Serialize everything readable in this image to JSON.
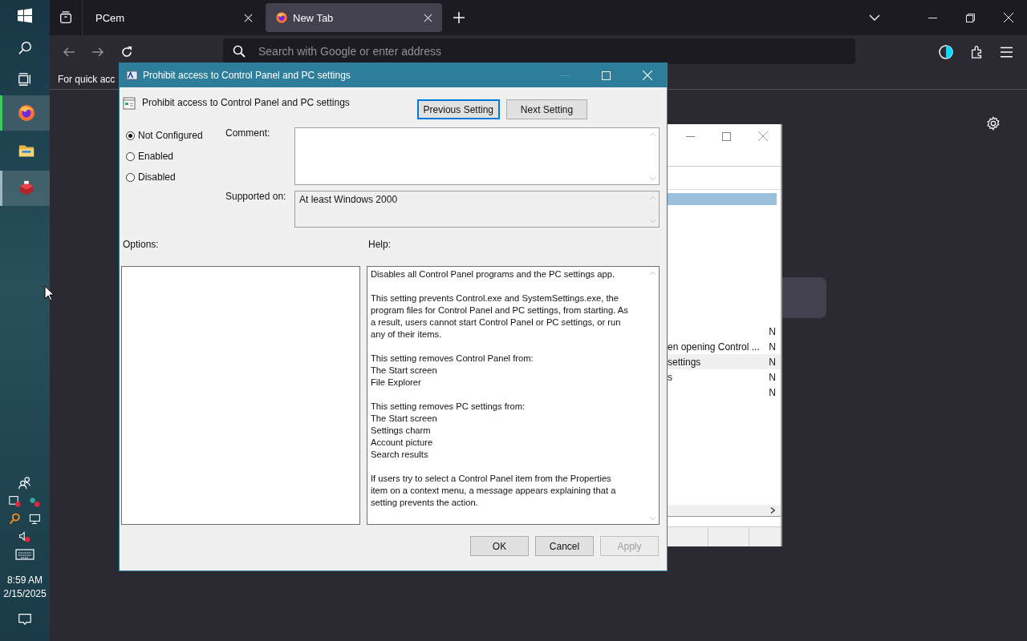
{
  "taskbar": {
    "apps": [
      {
        "kind": "firefox",
        "running": true
      },
      {
        "kind": "folder",
        "running": false
      },
      {
        "kind": "app",
        "running": true
      }
    ],
    "time": "8:59 AM",
    "date": "2/15/2025"
  },
  "browser": {
    "tabs": [
      {
        "label": "PCem",
        "selected": false,
        "kind": "plain"
      },
      {
        "label": "New Tab",
        "selected": true,
        "kind": "firefox"
      }
    ],
    "address": {
      "placeholder": "Search with Google or enter address"
    },
    "notice": "For quick acc"
  },
  "background_window": {
    "rows": [
      {
        "state": "N",
        "selected": false
      },
      {
        "name": "en opening Control ...",
        "state": "N",
        "selected": false
      },
      {
        "name": "settings",
        "state": "N",
        "selected": true
      },
      {
        "name": "s",
        "state": "N",
        "selected": false
      },
      {
        "state": "N",
        "selected": false
      }
    ]
  },
  "dialog": {
    "title": "Prohibit access to Control Panel and PC settings",
    "setting_name": "Prohibit access to Control Panel and PC settings",
    "nav_buttons": [
      {
        "label": "Previous Setting",
        "focused": true
      },
      {
        "label": "Next Setting",
        "focused": false
      }
    ],
    "options": [
      {
        "label": "Not Configured",
        "selected": true
      },
      {
        "label": "Enabled",
        "selected": false
      },
      {
        "label": "Disabled",
        "selected": false
      }
    ],
    "comment_label": "Comment:",
    "supported_label": "Supported on:",
    "supported_value": "At least Windows 2000",
    "options_label": "Options:",
    "help_label": "Help:",
    "help": [
      [
        "Disables all Control Panel programs and the PC settings app."
      ],
      [
        "This setting prevents Control.exe and SystemSettings.exe, the",
        "program files for Control Panel and PC settings, from starting. As",
        "a result, users cannot start Control Panel or PC settings, or run",
        "any of their items."
      ],
      [
        "This setting removes Control Panel from:",
        "The Start screen",
        "File Explorer"
      ],
      [
        "This setting removes PC settings from:",
        "The Start screen",
        "Settings charm",
        "Account picture",
        "Search results"
      ],
      [
        "If users try to select a Control Panel item from the Properties",
        "item on a context menu, a message appears explaining that a",
        "setting prevents the action."
      ]
    ],
    "buttons": [
      {
        "label": "OK",
        "disabled": false
      },
      {
        "label": "Cancel",
        "disabled": false
      },
      {
        "label": "Apply",
        "disabled": true
      }
    ]
  }
}
